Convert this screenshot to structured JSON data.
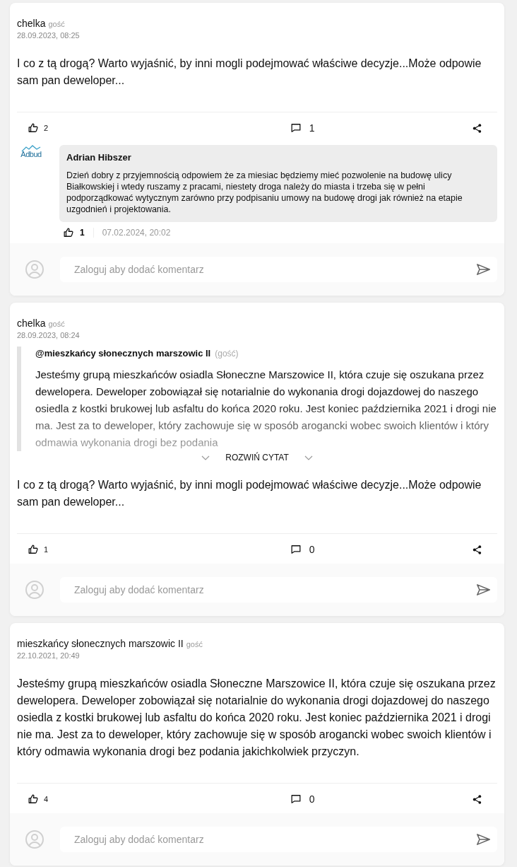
{
  "posts": [
    {
      "author": "chelka",
      "badge": "gość",
      "date": "28.09.2023, 08:25",
      "body": "I co z tą drogą? Warto wyjaśnić, by inni mogli podejmować właściwe decyzje...Może odpowie sam pan deweloper...",
      "likes": "2",
      "comments": "1",
      "replies": [
        {
          "author": "Adrian Hibszer",
          "logo_text": "Adbud",
          "body": "Dzień dobry z przyjemnością odpowiem że za miesiac będziemy mieć pozwolenie na budowę ulicy Białkowskiej i wtedy ruszamy z pracami, niestety droga należy do miasta i trzeba się w pełni podporządkować wytycznym zarówno przy podpisaniu umowy na budowę drogi jak również na etapie uzgodnień i projektowania.",
          "likes": "1",
          "date": "07.02.2024, 20:02"
        }
      ],
      "comment_placeholder": "Zaloguj aby dodać komentarz"
    },
    {
      "author": "chelka",
      "badge": "gość",
      "date": "28.09.2023, 08:24",
      "quote": {
        "author": "@mieszkańcy słonecznych marszowic II",
        "badge": "(gość)",
        "text": "Jesteśmy grupą mieszkańców osiadla Słoneczne Marszowice II, która czuje się oszukana przez dewelopera. Deweloper zobowiązał się notarialnie do wykonania drogi dojazdowej do naszego osiedla z kostki brukowej lub asfaltu do końca 2020 roku. Jest koniec października 2021 i drogi nie ma. Jest za to deweloper, który zachowuje się w sposób arogancki wobec swoich klientów i który odmawia wykonania drogi bez podania",
        "expand_label": "ROZWIŃ CYTAT"
      },
      "body": "I co z tą drogą? Warto wyjaśnić, by inni mogli podejmować właściwe decyzje...Może odpowie sam pan deweloper...",
      "likes": "1",
      "comments": "0",
      "comment_placeholder": "Zaloguj aby dodać komentarz"
    },
    {
      "author": "mieszkańcy słonecznych marszowic II",
      "badge": "gość",
      "date": "22.10.2021, 20:49",
      "body": "Jesteśmy grupą mieszkańców osiadla Słoneczne Marszowice II, która czuje się oszukana przez dewelopera. Deweloper zobowiązał się notarialnie do wykonania drogi dojazdowej do naszego osiedla z kostki brukowej lub asfaltu do końca 2020 roku. Jest koniec października 2021 i drogi nie ma. Jest za to deweloper, który zachowuje się w sposób arogancki wobec swoich klientów i który odmawia wykonania drogi bez podania jakichkolwiek przyczyn.",
      "likes": "4",
      "comments": "0",
      "comment_placeholder": "Zaloguj aby dodać komentarz"
    }
  ]
}
